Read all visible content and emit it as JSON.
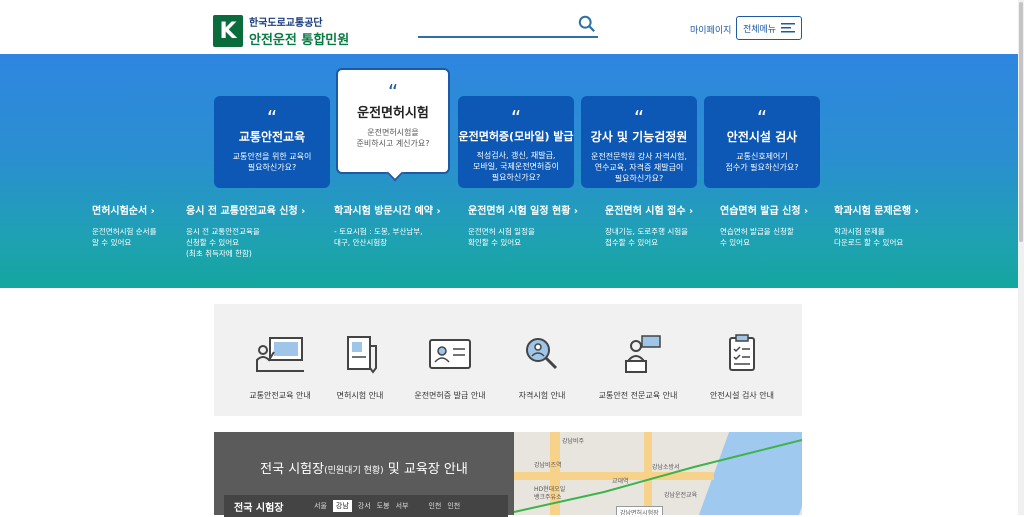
{
  "header": {
    "logo_mark": "K",
    "logo_line1": "한국도로교통공단",
    "logo_line2": "안전운전 통합민원",
    "mypage": "마이페이지",
    "menu": "전체메뉴"
  },
  "cards": [
    {
      "title": "교통안전교육",
      "desc": "교통안전을 위한 교육이\n필요하신가요?"
    },
    {
      "title": "운전면허시험",
      "desc": "운전면허시험을\n준비하시고 계신가요?"
    },
    {
      "title": "운전면허증(모바일) 발급",
      "desc": "적성검사, 갱신, 재발급,\n모바일, 국제운전면허증이\n필요하신가요?"
    },
    {
      "title": "강사 및 기능검정원",
      "desc": "운전전문학원 강사 자격시험,\n연수교육, 자격증 재발급이\n필요하신가요?"
    },
    {
      "title": "안전시설 검사",
      "desc": "교통신호제어기\n접수가 필요하신가요?"
    }
  ],
  "links": [
    {
      "title": "면허시험순서 ›",
      "desc": "운전면허시험 순서를\n알 수 있어요"
    },
    {
      "title": "응시 전 교통안전교육 신청 ›",
      "desc": "응시 전 교통안전교육을\n신청할 수 있어요\n(최초 취득자에 한함)"
    },
    {
      "title": "학과시험 방문시간 예약 ›",
      "desc": "- 토요시험 : 도봉, 부산남부,\n  대구, 안산시험장"
    },
    {
      "title": "운전면허 시험 일정 현황 ›",
      "desc": "운전면허 시험 일정을\n확인할 수 있어요"
    },
    {
      "title": "운전면허 시험 접수 ›",
      "desc": "장내기능, 도로주행 시험을\n접수할 수 있어요"
    },
    {
      "title": "연습면허 발급 신청 ›",
      "desc": "연습면허 발급을 신청할\n수 있어요"
    },
    {
      "title": "학과시험 문제은행 ›",
      "desc": "학과시험 문제를\n다운로드 할 수 있어요"
    }
  ],
  "quick": [
    "교통안전교육 안내",
    "면허시험 안내",
    "운전면허증 발급 안내",
    "자격시험 안내",
    "교통안전 전문교육 안내",
    "안전시설 검사 안내"
  ],
  "centers": {
    "title": "전국 시험장",
    "title_small": "(민원대기 현황)",
    "title_end": " 및 교육장 안내",
    "tab_lead": "전국 시험장",
    "regions": [
      "서울",
      "강남",
      "강서",
      "도봉",
      "서부",
      "인천",
      "인천"
    ],
    "active": "강남"
  },
  "map": {
    "labels": [
      "강남비주",
      "강남비즈역",
      "교대역",
      "강남소방서",
      "HD현대오일",
      "뱅크주유소",
      "강남면허시험장",
      "강남운전교육"
    ]
  }
}
